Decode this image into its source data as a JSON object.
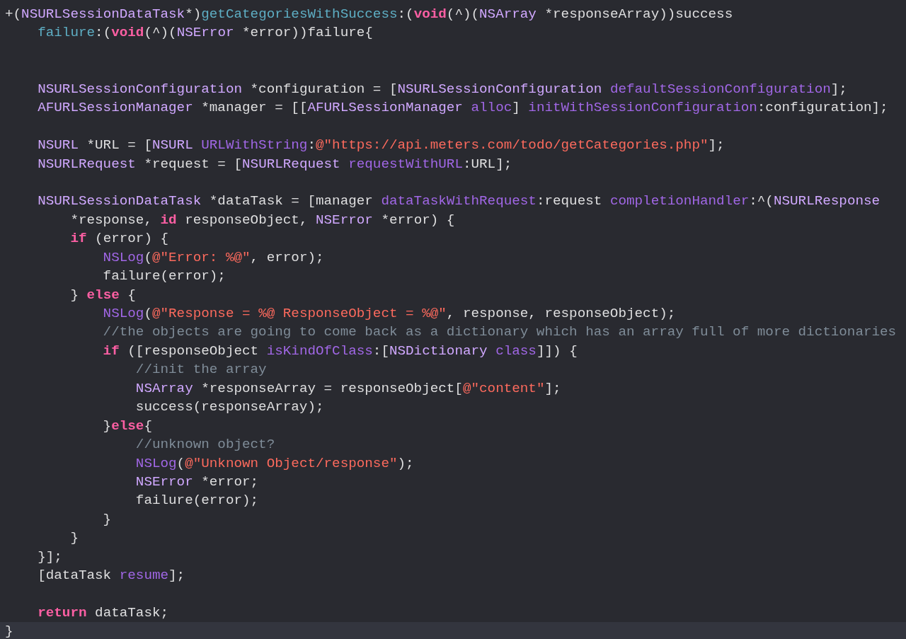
{
  "editor": {
    "lines": [
      {
        "current": false,
        "tokens": [
          {
            "kind": "plain",
            "text": "+("
          },
          {
            "kind": "type",
            "text": "NSURLSessionDataTask"
          },
          {
            "kind": "plain",
            "text": "*)"
          },
          {
            "kind": "decl",
            "text": "getCategoriesWithSuccess"
          },
          {
            "kind": "plain",
            "text": ":("
          },
          {
            "kind": "keyword",
            "text": "void"
          },
          {
            "kind": "plain",
            "text": "(^)("
          },
          {
            "kind": "type",
            "text": "NSArray"
          },
          {
            "kind": "plain",
            "text": " *responseArray))success"
          }
        ]
      },
      {
        "current": false,
        "tokens": [
          {
            "kind": "decl",
            "text": "    failure"
          },
          {
            "kind": "plain",
            "text": ":("
          },
          {
            "kind": "keyword",
            "text": "void"
          },
          {
            "kind": "plain",
            "text": "(^)("
          },
          {
            "kind": "type",
            "text": "NSError"
          },
          {
            "kind": "plain",
            "text": " *error))failure{"
          }
        ]
      },
      {
        "current": false
      },
      {
        "current": false
      },
      {
        "current": false,
        "tokens": [
          {
            "kind": "type",
            "text": "    NSURLSessionConfiguration"
          },
          {
            "kind": "plain",
            "text": " *configuration = ["
          },
          {
            "kind": "type",
            "text": "NSURLSessionConfiguration "
          },
          {
            "kind": "method",
            "text": "defaultSessionConfiguration"
          },
          {
            "kind": "plain",
            "text": "];"
          }
        ]
      },
      {
        "current": false,
        "tokens": [
          {
            "kind": "type",
            "text": "    AFURLSessionManager"
          },
          {
            "kind": "plain",
            "text": " *manager = [["
          },
          {
            "kind": "type",
            "text": "AFURLSessionManager "
          },
          {
            "kind": "method",
            "text": "alloc"
          },
          {
            "kind": "plain",
            "text": "] "
          },
          {
            "kind": "method",
            "text": "initWithSessionConfiguration"
          },
          {
            "kind": "plain",
            "text": ":configuration];"
          }
        ]
      },
      {
        "current": false
      },
      {
        "current": false,
        "tokens": [
          {
            "kind": "type",
            "text": "    NSURL"
          },
          {
            "kind": "plain",
            "text": " *URL = ["
          },
          {
            "kind": "type",
            "text": "NSURL "
          },
          {
            "kind": "method",
            "text": "URLWithString"
          },
          {
            "kind": "plain",
            "text": ":"
          },
          {
            "kind": "string",
            "text": "@\"https://api.meters.com/todo/getCategories.php\""
          },
          {
            "kind": "plain",
            "text": "];"
          }
        ]
      },
      {
        "current": false,
        "tokens": [
          {
            "kind": "type",
            "text": "    NSURLRequest"
          },
          {
            "kind": "plain",
            "text": " *request = ["
          },
          {
            "kind": "type",
            "text": "NSURLRequest "
          },
          {
            "kind": "method",
            "text": "requestWithURL"
          },
          {
            "kind": "plain",
            "text": ":URL];"
          }
        ]
      },
      {
        "current": false
      },
      {
        "current": false,
        "tokens": [
          {
            "kind": "type",
            "text": "    NSURLSessionDataTask"
          },
          {
            "kind": "plain",
            "text": " *dataTask = [manager "
          },
          {
            "kind": "method",
            "text": "dataTaskWithRequest"
          },
          {
            "kind": "plain",
            "text": ":request "
          },
          {
            "kind": "method",
            "text": "completionHandler"
          },
          {
            "kind": "plain",
            "text": ":^("
          },
          {
            "kind": "type",
            "text": "NSURLResponse"
          }
        ]
      },
      {
        "current": false,
        "tokens": [
          {
            "kind": "plain",
            "text": "        *response, "
          },
          {
            "kind": "keyword",
            "text": "id"
          },
          {
            "kind": "plain",
            "text": " responseObject, "
          },
          {
            "kind": "type",
            "text": "NSError"
          },
          {
            "kind": "plain",
            "text": " *error) {"
          }
        ]
      },
      {
        "current": false,
        "tokens": [
          {
            "kind": "keyword",
            "text": "        if"
          },
          {
            "kind": "plain",
            "text": " (error) {"
          }
        ]
      },
      {
        "current": false,
        "tokens": [
          {
            "kind": "method",
            "text": "            NSLog"
          },
          {
            "kind": "plain",
            "text": "("
          },
          {
            "kind": "string",
            "text": "@\"Error: %@\""
          },
          {
            "kind": "plain",
            "text": ", error);"
          }
        ]
      },
      {
        "current": false,
        "tokens": [
          {
            "kind": "plain",
            "text": "            failure(error);"
          }
        ]
      },
      {
        "current": false,
        "tokens": [
          {
            "kind": "plain",
            "text": "        } "
          },
          {
            "kind": "keyword",
            "text": "else"
          },
          {
            "kind": "plain",
            "text": " {"
          }
        ]
      },
      {
        "current": false,
        "tokens": [
          {
            "kind": "method",
            "text": "            NSLog"
          },
          {
            "kind": "plain",
            "text": "("
          },
          {
            "kind": "string",
            "text": "@\"Response = %@ ResponseObject = %@\""
          },
          {
            "kind": "plain",
            "text": ", response, responseObject);"
          }
        ]
      },
      {
        "current": false,
        "tokens": [
          {
            "kind": "comment",
            "text": "            //the objects are going to come back as a dictionary which has an array full of more dictionaries"
          }
        ]
      },
      {
        "current": false,
        "tokens": [
          {
            "kind": "keyword",
            "text": "            if"
          },
          {
            "kind": "plain",
            "text": " ([responseObject "
          },
          {
            "kind": "method",
            "text": "isKindOfClass"
          },
          {
            "kind": "plain",
            "text": ":["
          },
          {
            "kind": "type",
            "text": "NSDictionary "
          },
          {
            "kind": "method",
            "text": "class"
          },
          {
            "kind": "plain",
            "text": "]]) {"
          }
        ]
      },
      {
        "current": false,
        "tokens": [
          {
            "kind": "comment",
            "text": "                //init the array"
          }
        ]
      },
      {
        "current": false,
        "tokens": [
          {
            "kind": "type",
            "text": "                NSArray"
          },
          {
            "kind": "plain",
            "text": " *responseArray = responseObject["
          },
          {
            "kind": "string",
            "text": "@\"content\""
          },
          {
            "kind": "plain",
            "text": "];"
          }
        ]
      },
      {
        "current": false,
        "tokens": [
          {
            "kind": "plain",
            "text": "                success(responseArray);"
          }
        ]
      },
      {
        "current": false,
        "tokens": [
          {
            "kind": "plain",
            "text": "            }"
          },
          {
            "kind": "keyword",
            "text": "else"
          },
          {
            "kind": "plain",
            "text": "{"
          }
        ]
      },
      {
        "current": false,
        "tokens": [
          {
            "kind": "comment",
            "text": "                //unknown object?"
          }
        ]
      },
      {
        "current": false,
        "tokens": [
          {
            "kind": "method",
            "text": "                NSLog"
          },
          {
            "kind": "plain",
            "text": "("
          },
          {
            "kind": "string",
            "text": "@\"Unknown Object/response\""
          },
          {
            "kind": "plain",
            "text": ");"
          }
        ]
      },
      {
        "current": false,
        "tokens": [
          {
            "kind": "type",
            "text": "                NSError"
          },
          {
            "kind": "plain",
            "text": " *error;"
          }
        ]
      },
      {
        "current": false,
        "tokens": [
          {
            "kind": "plain",
            "text": "                failure(error);"
          }
        ]
      },
      {
        "current": false,
        "tokens": [
          {
            "kind": "plain",
            "text": "            }"
          }
        ]
      },
      {
        "current": false,
        "tokens": [
          {
            "kind": "plain",
            "text": "        }"
          }
        ]
      },
      {
        "current": false,
        "tokens": [
          {
            "kind": "plain",
            "text": "    }];"
          }
        ]
      },
      {
        "current": false,
        "tokens": [
          {
            "kind": "plain",
            "text": "    [dataTask "
          },
          {
            "kind": "method",
            "text": "resume"
          },
          {
            "kind": "plain",
            "text": "];"
          }
        ]
      },
      {
        "current": false
      },
      {
        "current": false,
        "tokens": [
          {
            "kind": "keyword",
            "text": "    return"
          },
          {
            "kind": "plain",
            "text": " dataTask;"
          }
        ]
      },
      {
        "current": true,
        "tokens": [
          {
            "kind": "plain",
            "text": "}"
          }
        ]
      }
    ]
  }
}
